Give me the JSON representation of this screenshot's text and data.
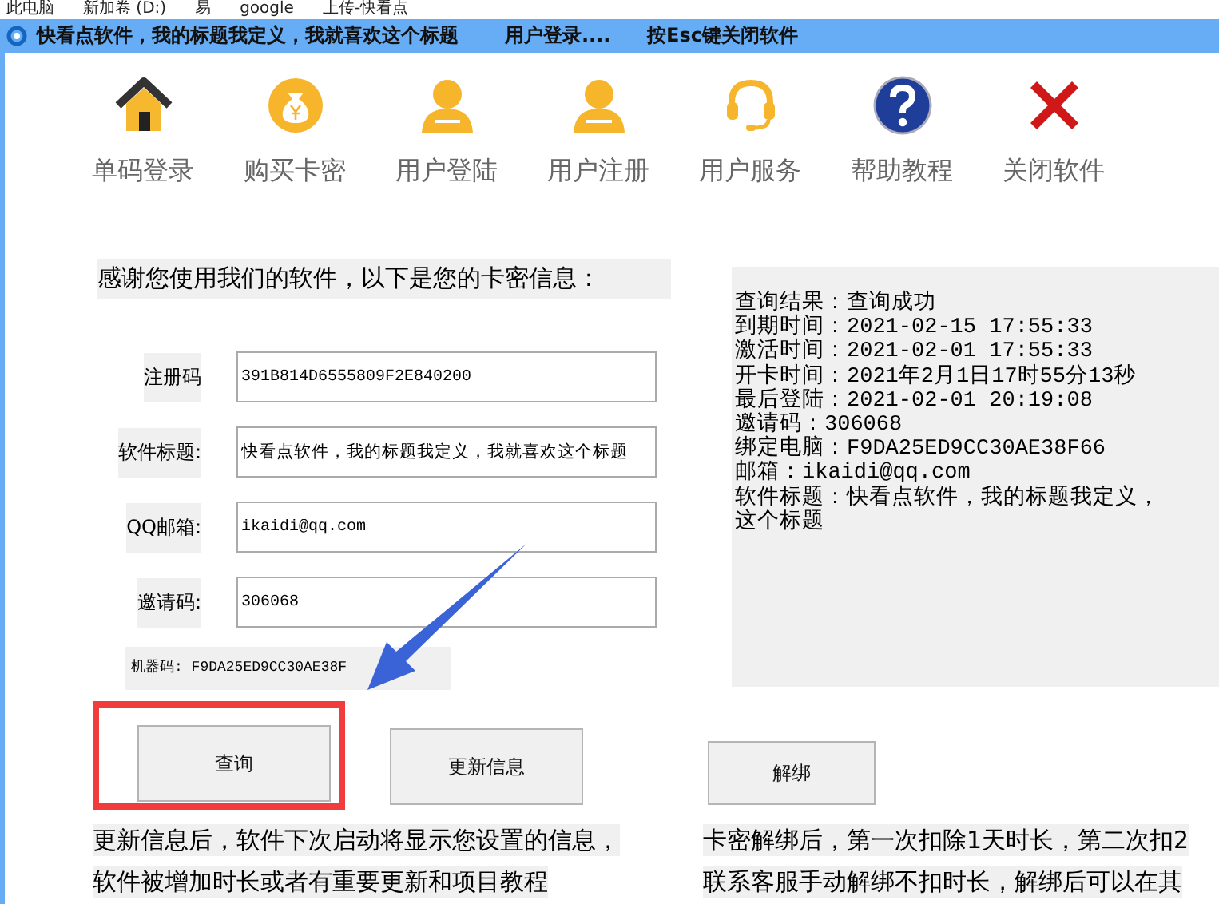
{
  "breadcrumb": [
    "此电脑",
    "新加卷 (D:)",
    "易",
    "google",
    "上传-快看点"
  ],
  "title_bar": {
    "items": [
      "快看点软件，我的标题我定义，我就喜欢这个标题",
      "用户登录....",
      "按Esc键关闭软件"
    ]
  },
  "toolbar": [
    {
      "label": "单码登录",
      "kind": "home"
    },
    {
      "label": "购买卡密",
      "kind": "coin"
    },
    {
      "label": "用户登陆",
      "kind": "vip"
    },
    {
      "label": "用户注册",
      "kind": "vip"
    },
    {
      "label": "用户服务",
      "kind": "headset"
    },
    {
      "label": "帮助教程",
      "kind": "help"
    },
    {
      "label": "关闭软件",
      "kind": "close"
    }
  ],
  "intro": "感谢您使用我们的软件，以下是您的卡密信息：",
  "fields": [
    {
      "label": "注册码",
      "value": "391B814D6555809F2E840200"
    },
    {
      "label": "软件标题:",
      "value": "快看点软件，我的标题我定义，我就喜欢这个标题"
    },
    {
      "label": "QQ邮箱:",
      "value": "ikaidi@qq.com"
    },
    {
      "label": "邀请码:",
      "value": "306068"
    }
  ],
  "machine_code": "机器码: F9DA25ED9CC30AE38F",
  "result_lines": [
    "查询结果：查询成功",
    "到期时间：2021-02-15 17:55:33",
    "激活时间：2021-02-01 17:55:33",
    "开卡时间：2021年2月1日17时55分13秒",
    "最后登陆：2021-02-01 20:19:08",
    "邀请码：306068",
    "绑定电脑：F9DA25ED9CC30AE38F66",
    "邮箱：ikaidi@qq.com",
    "软件标题：快看点软件，我的标题我定义，",
    "这个标题"
  ],
  "buttons": [
    {
      "label": "查询",
      "highlighted": true
    },
    {
      "label": "更新信息",
      "highlighted": false
    },
    {
      "label": "解绑",
      "highlighted": false
    }
  ],
  "notes_left": [
    "更新信息后，软件下次启动将显示您设置的信息，",
    "软件被增加时长或者有重要更新和项目教程"
  ],
  "notes_right": [
    "卡密解绑后，第一次扣除1天时长，第二次扣2",
    "联系客服手动解绑不扣时长，解绑后可以在其"
  ]
}
